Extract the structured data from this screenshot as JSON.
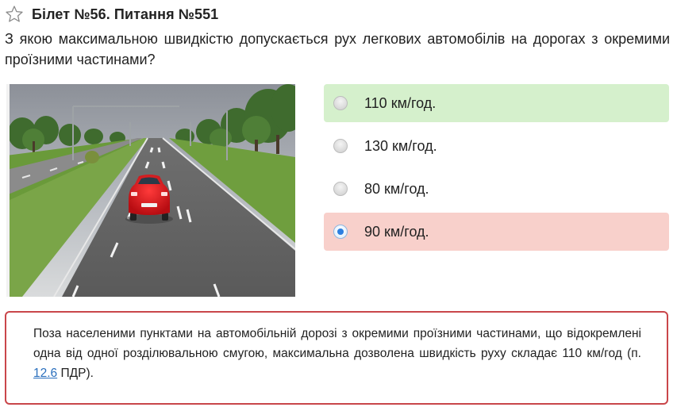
{
  "header": {
    "title": "Білет №56. Питання №551",
    "favorite_icon": "star-outline-icon"
  },
  "question": {
    "text": "З якою максимальною швидкістю допускається рух легкових автомобілів на дорогах з окремими проїзними частинами?"
  },
  "answers": [
    {
      "label": "110 км/год.",
      "state": "correct",
      "selected": false
    },
    {
      "label": "130 км/год.",
      "state": "neutral",
      "selected": false
    },
    {
      "label": "80 км/год.",
      "state": "neutral",
      "selected": false
    },
    {
      "label": "90 км/год.",
      "state": "wrong",
      "selected": true
    }
  ],
  "explanation": {
    "text_before": "Поза населеними пунктами на автомобільній дорозі з окремими проїзними частинами, що відокремлені одна від одної розділювальною смугою, максимальна дозволена швидкість руху складає 110 км/год (п. ",
    "link_text": "12.6",
    "text_after": " ПДР)."
  },
  "colors": {
    "correct_bg": "#d5f0cc",
    "wrong_bg": "#f8d0cb",
    "explanation_border": "#c9464a",
    "link": "#2a6fbd",
    "radio_checked": "#2d7fe0"
  }
}
